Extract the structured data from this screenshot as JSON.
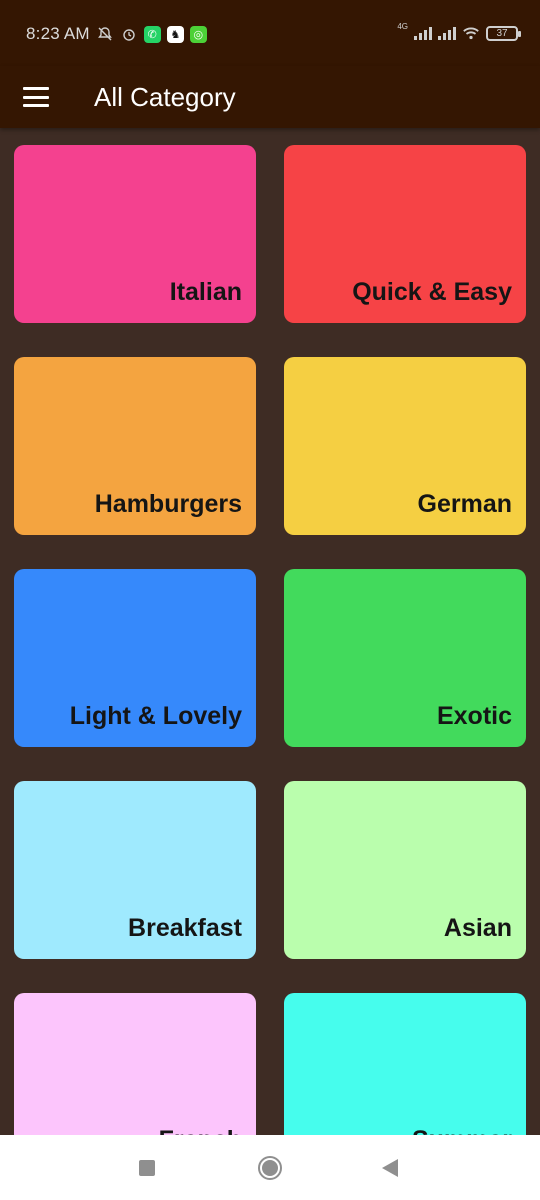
{
  "status_bar": {
    "time": "8:23 AM",
    "network_label": "4G",
    "battery": "37",
    "icons": [
      "mute-bell-icon",
      "alarm-icon",
      "whatsapp-icon",
      "app-icon",
      "app-icon",
      "signal-icon",
      "signal-icon",
      "wifi-icon",
      "battery-icon"
    ]
  },
  "app_bar": {
    "title": "All Category",
    "menu_icon": "hamburger-menu-icon"
  },
  "categories": [
    {
      "label": "Italian",
      "color": "#f4418f"
    },
    {
      "label": "Quick & Easy",
      "color": "#f64346"
    },
    {
      "label": "Hamburgers",
      "color": "#f4a440"
    },
    {
      "label": "German",
      "color": "#f5cf42"
    },
    {
      "label": "Light & Lovely",
      "color": "#3689fb"
    },
    {
      "label": "Exotic",
      "color": "#42da5c"
    },
    {
      "label": "Breakfast",
      "color": "#9feafe"
    },
    {
      "label": "Asian",
      "color": "#bafead"
    },
    {
      "label": "French",
      "color": "#fcc5fc"
    },
    {
      "label": "Summer",
      "color": "#46fded"
    }
  ],
  "nav_bar": {
    "icons": [
      "recent-apps-icon",
      "home-icon",
      "back-icon"
    ]
  }
}
